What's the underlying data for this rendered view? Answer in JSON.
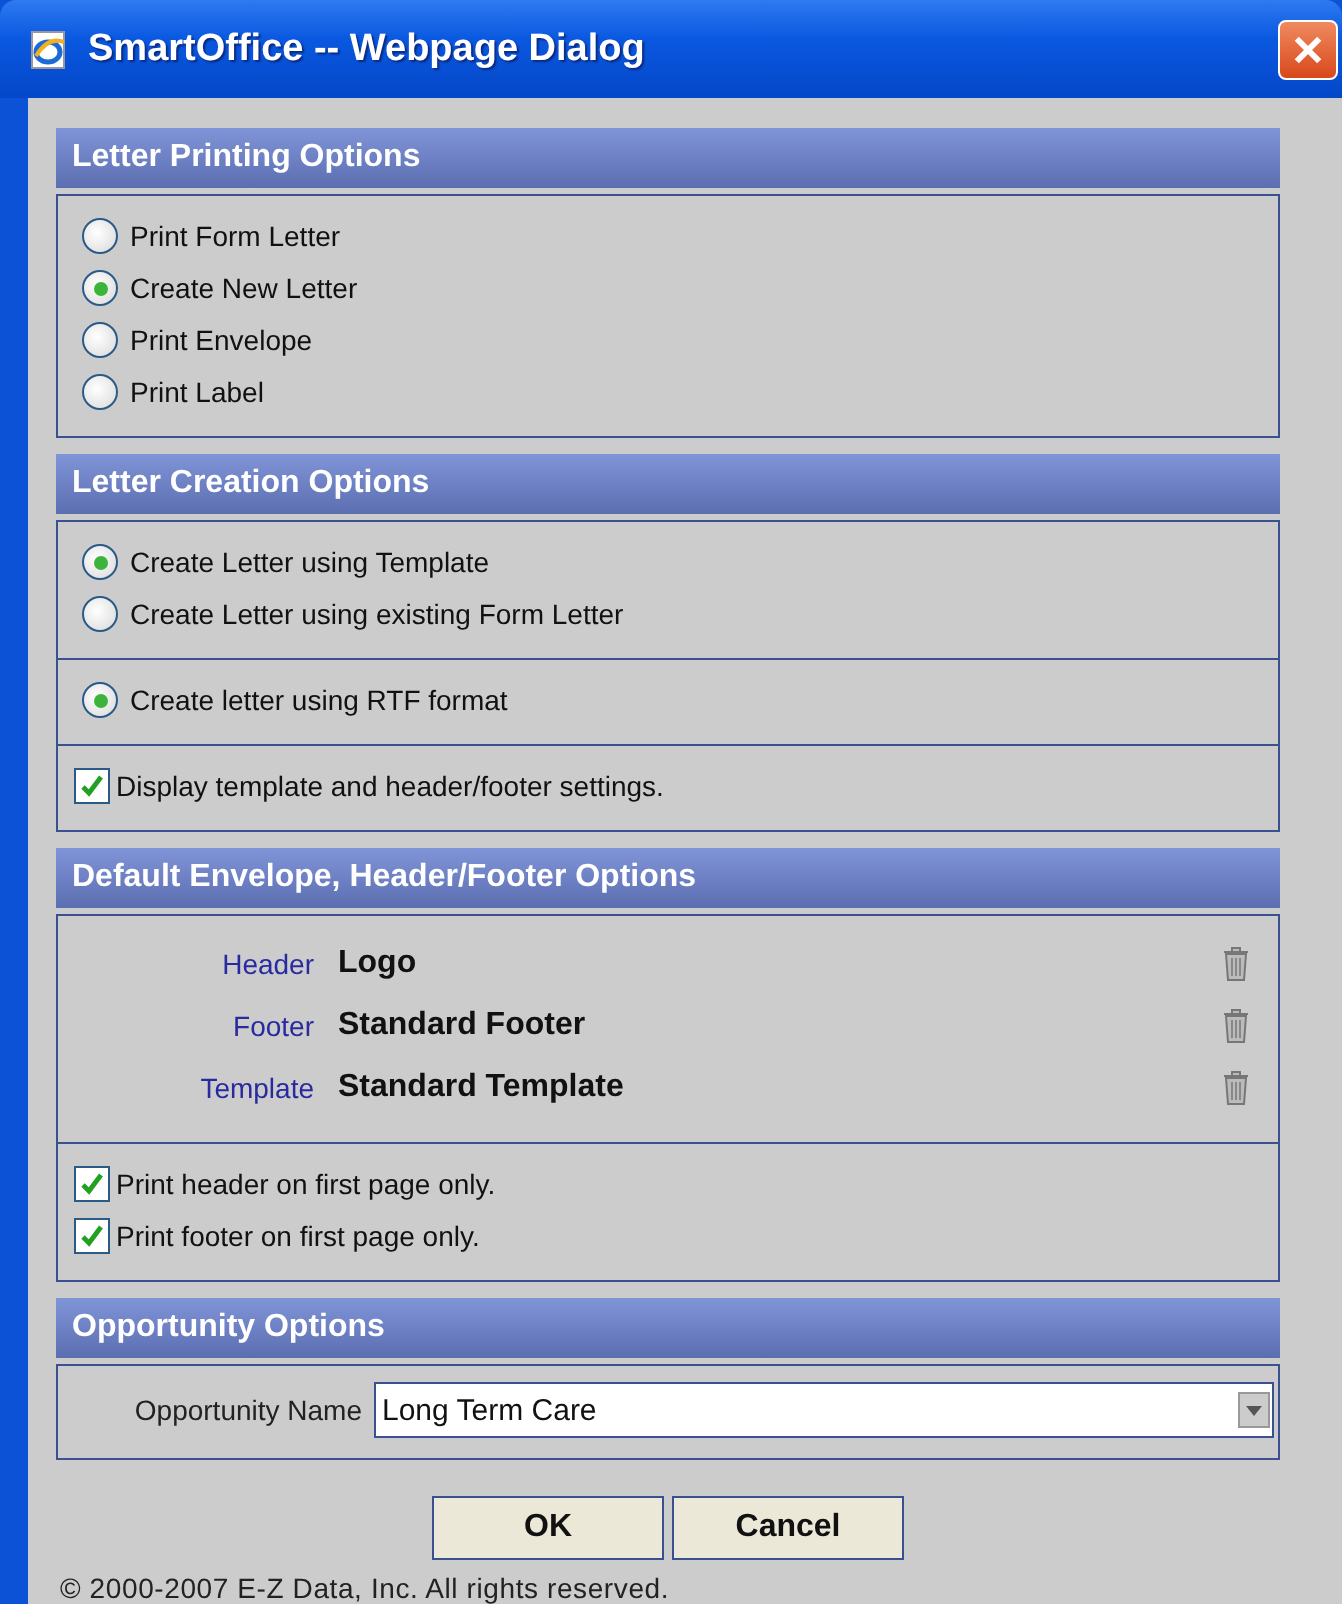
{
  "window": {
    "title": "SmartOffice -- Webpage Dialog"
  },
  "sections": [
    {
      "title": "Letter Printing Options",
      "groups": [
        {
          "kind": "radios",
          "items": [
            {
              "label": "Print Form Letter",
              "selected": false
            },
            {
              "label": "Create New Letter",
              "selected": true
            },
            {
              "label": "Print Envelope",
              "selected": false
            },
            {
              "label": "Print Label",
              "selected": false
            }
          ]
        }
      ]
    },
    {
      "title": "Letter Creation Options",
      "groups": [
        {
          "kind": "radios",
          "items": [
            {
              "label": "Create Letter using Template",
              "selected": true
            },
            {
              "label": "Create Letter using existing Form Letter",
              "selected": false
            }
          ]
        },
        {
          "kind": "radios",
          "items": [
            {
              "label": "Create letter using RTF format",
              "selected": true
            }
          ]
        },
        {
          "kind": "checks",
          "items": [
            {
              "label": "Display template and header/footer settings.",
              "checked": true
            }
          ]
        }
      ]
    },
    {
      "title": "Default Envelope, Header/Footer Options",
      "groups": [
        {
          "kind": "settings",
          "rows": [
            {
              "label": "Header",
              "value": "Logo"
            },
            {
              "label": "Footer",
              "value": "Standard Footer"
            },
            {
              "label": "Template",
              "value": "Standard Template"
            }
          ]
        },
        {
          "kind": "checks",
          "items": [
            {
              "label": "Print header on first page only.",
              "checked": true
            },
            {
              "label": "Print footer on first page only.",
              "checked": true
            }
          ]
        }
      ]
    },
    {
      "title": "Opportunity Options",
      "groups": [
        {
          "kind": "select",
          "label": "Opportunity Name",
          "value": "Long Term Care"
        }
      ]
    }
  ],
  "buttons": [
    "OK",
    "Cancel"
  ],
  "copyright": "© 2000-2007 E-Z Data, Inc. All rights reserved."
}
